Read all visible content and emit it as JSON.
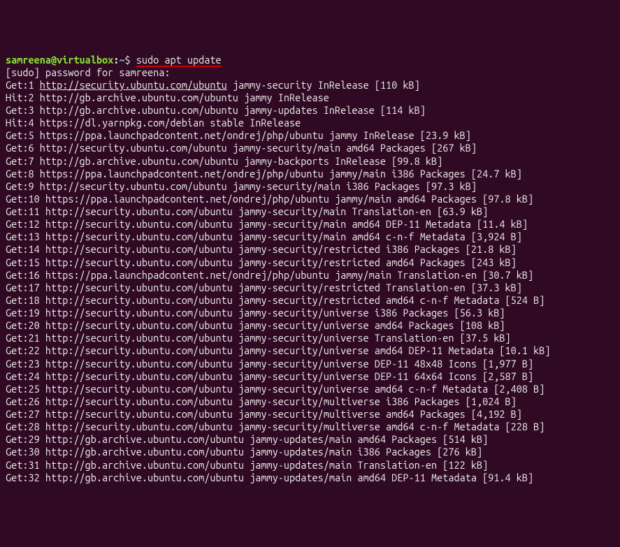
{
  "prompt": {
    "user_host": "samreena@virtualbox",
    "colon": ":",
    "path": "~",
    "symbol": "$ ",
    "command": "sudo apt update"
  },
  "lines": [
    "[sudo] password for samreena:",
    "Get:1 http://security.ubuntu.com/ubuntu jammy-security InRelease [110 kB]",
    "Hit:2 http://gb.archive.ubuntu.com/ubuntu jammy InRelease",
    "Get:3 http://gb.archive.ubuntu.com/ubuntu jammy-updates InRelease [114 kB]",
    "Hit:4 https://dl.yarnpkg.com/debian stable InRelease",
    "Get:5 https://ppa.launchpadcontent.net/ondrej/php/ubuntu jammy InRelease [23.9 kB]",
    "Get:6 http://security.ubuntu.com/ubuntu jammy-security/main amd64 Packages [267 kB]",
    "Get:7 http://gb.archive.ubuntu.com/ubuntu jammy-backports InRelease [99.8 kB]",
    "Get:8 https://ppa.launchpadcontent.net/ondrej/php/ubuntu jammy/main i386 Packages [24.7 kB]",
    "Get:9 http://security.ubuntu.com/ubuntu jammy-security/main i386 Packages [97.3 kB]",
    "Get:10 https://ppa.launchpadcontent.net/ondrej/php/ubuntu jammy/main amd64 Packages [97.8 kB]",
    "Get:11 http://security.ubuntu.com/ubuntu jammy-security/main Translation-en [63.9 kB]",
    "Get:12 http://security.ubuntu.com/ubuntu jammy-security/main amd64 DEP-11 Metadata [11.4 kB]",
    "Get:13 http://security.ubuntu.com/ubuntu jammy-security/main amd64 c-n-f Metadata [3,924 B]",
    "Get:14 http://security.ubuntu.com/ubuntu jammy-security/restricted i386 Packages [21.8 kB]",
    "Get:15 http://security.ubuntu.com/ubuntu jammy-security/restricted amd64 Packages [243 kB]",
    "Get:16 https://ppa.launchpadcontent.net/ondrej/php/ubuntu jammy/main Translation-en [30.7 kB]",
    "Get:17 http://security.ubuntu.com/ubuntu jammy-security/restricted Translation-en [37.3 kB]",
    "Get:18 http://security.ubuntu.com/ubuntu jammy-security/restricted amd64 c-n-f Metadata [524 B]",
    "Get:19 http://security.ubuntu.com/ubuntu jammy-security/universe i386 Packages [56.3 kB]",
    "Get:20 http://security.ubuntu.com/ubuntu jammy-security/universe amd64 Packages [108 kB]",
    "Get:21 http://security.ubuntu.com/ubuntu jammy-security/universe Translation-en [37.5 kB]",
    "Get:22 http://security.ubuntu.com/ubuntu jammy-security/universe amd64 DEP-11 Metadata [10.1 kB]",
    "Get:23 http://security.ubuntu.com/ubuntu jammy-security/universe DEP-11 48x48 Icons [1,977 B]",
    "Get:24 http://security.ubuntu.com/ubuntu jammy-security/universe DEP-11 64x64 Icons [2,587 B]",
    "Get:25 http://security.ubuntu.com/ubuntu jammy-security/universe amd64 c-n-f Metadata [2,408 B]",
    "Get:26 http://security.ubuntu.com/ubuntu jammy-security/multiverse i386 Packages [1,024 B]",
    "Get:27 http://security.ubuntu.com/ubuntu jammy-security/multiverse amd64 Packages [4,192 B]",
    "Get:28 http://security.ubuntu.com/ubuntu jammy-security/multiverse amd64 c-n-f Metadata [228 B]",
    "Get:29 http://gb.archive.ubuntu.com/ubuntu jammy-updates/main amd64 Packages [514 kB]",
    "Get:30 http://gb.archive.ubuntu.com/ubuntu jammy-updates/main i386 Packages [276 kB]",
    "Get:31 http://gb.archive.ubuntu.com/ubuntu jammy-updates/main Translation-en [122 kB]",
    "Get:32 http://gb.archive.ubuntu.com/ubuntu jammy-updates/main amd64 DEP-11 Metadata [91.4 kB]"
  ],
  "url_underline_line_index": 1,
  "url_underline_text": "http://security.ubuntu.com/ubuntu"
}
